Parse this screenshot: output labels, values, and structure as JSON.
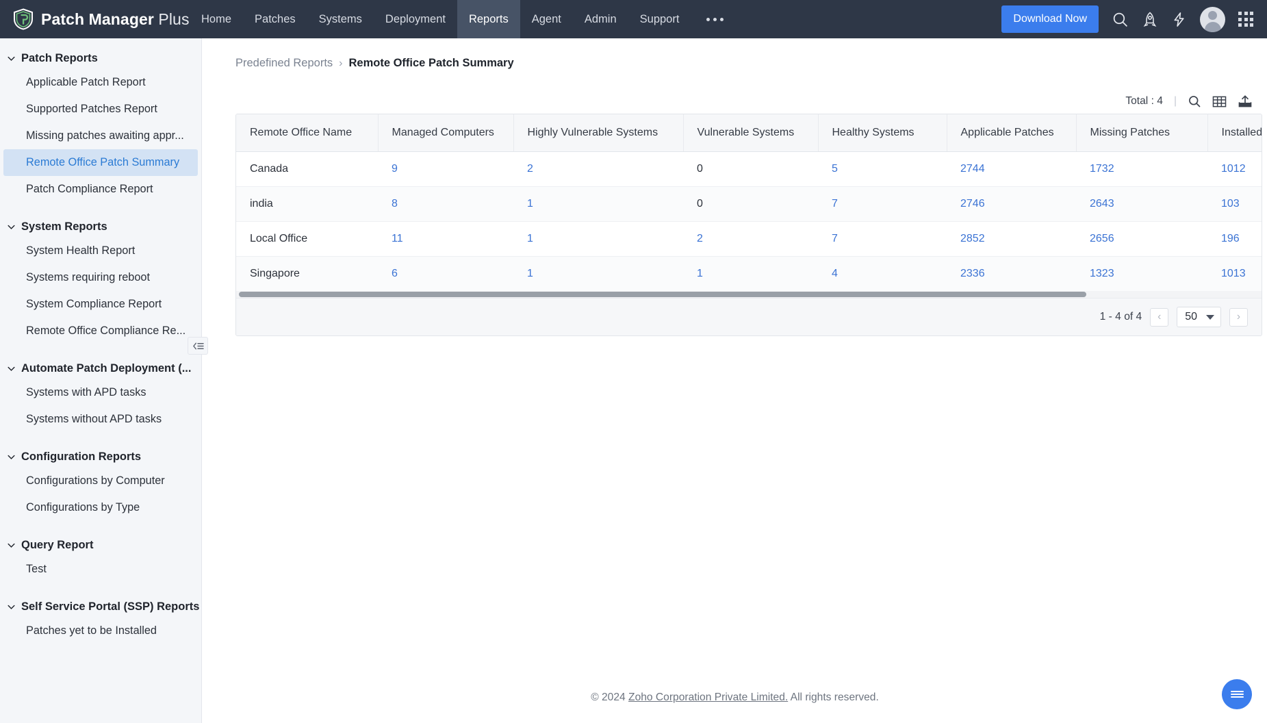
{
  "header": {
    "brand_bold": "Patch Manager",
    "brand_light": "Plus",
    "nav": [
      {
        "label": "Home",
        "active": false
      },
      {
        "label": "Patches",
        "active": false
      },
      {
        "label": "Systems",
        "active": false
      },
      {
        "label": "Deployment",
        "active": false
      },
      {
        "label": "Reports",
        "active": true
      },
      {
        "label": "Agent",
        "active": false
      },
      {
        "label": "Admin",
        "active": false
      },
      {
        "label": "Support",
        "active": false
      }
    ],
    "more_label": "more-menu",
    "download_label": "Download Now",
    "icons": [
      "search-icon",
      "rocket-icon",
      "lightning-icon",
      "avatar",
      "apps-grid-icon"
    ]
  },
  "sidebar": {
    "groups": [
      {
        "title": "Patch Reports",
        "items": [
          {
            "label": "Applicable Patch Report",
            "active": false
          },
          {
            "label": "Supported Patches Report",
            "active": false
          },
          {
            "label": "Missing patches awaiting appr...",
            "active": false
          },
          {
            "label": "Remote Office Patch Summary",
            "active": true
          },
          {
            "label": "Patch Compliance Report",
            "active": false
          }
        ]
      },
      {
        "title": "System Reports",
        "items": [
          {
            "label": "System Health Report",
            "active": false
          },
          {
            "label": "Systems requiring reboot",
            "active": false
          },
          {
            "label": "System Compliance Report",
            "active": false
          },
          {
            "label": "Remote Office Compliance Re...",
            "active": false
          }
        ]
      },
      {
        "title": "Automate Patch Deployment (...",
        "items": [
          {
            "label": "Systems with APD tasks",
            "active": false
          },
          {
            "label": "Systems without APD tasks",
            "active": false
          }
        ]
      },
      {
        "title": "Configuration Reports",
        "items": [
          {
            "label": "Configurations by Computer",
            "active": false
          },
          {
            "label": "Configurations by Type",
            "active": false
          }
        ]
      },
      {
        "title": "Query Report",
        "items": [
          {
            "label": "Test",
            "active": false
          }
        ]
      },
      {
        "title": "Self Service Portal (SSP) Reports",
        "items": [
          {
            "label": "Patches yet to be Installed",
            "active": false
          }
        ]
      }
    ],
    "collapse_icon": "collapse-sidebar-icon"
  },
  "breadcrumb": {
    "parent": "Predefined Reports",
    "separator": "›",
    "current": "Remote Office Patch Summary"
  },
  "toolbar": {
    "total_label": "Total : 4",
    "divider": "|",
    "icons": [
      "search-icon",
      "column-settings-icon",
      "export-icon"
    ]
  },
  "table": {
    "columns": [
      "Remote Office Name",
      "Managed Computers",
      "Highly Vulnerable Systems",
      "Vulnerable Systems",
      "Healthy Systems",
      "Applicable Patches",
      "Missing Patches",
      "Installed Pa"
    ],
    "rows": [
      {
        "cells": [
          {
            "v": "Canada",
            "link": false
          },
          {
            "v": "9",
            "link": true
          },
          {
            "v": "2",
            "link": true
          },
          {
            "v": "0",
            "link": false
          },
          {
            "v": "5",
            "link": true
          },
          {
            "v": "2744",
            "link": true
          },
          {
            "v": "1732",
            "link": true
          },
          {
            "v": "1012",
            "link": true
          }
        ]
      },
      {
        "cells": [
          {
            "v": "india",
            "link": false
          },
          {
            "v": "8",
            "link": true
          },
          {
            "v": "1",
            "link": true
          },
          {
            "v": "0",
            "link": false
          },
          {
            "v": "7",
            "link": true
          },
          {
            "v": "2746",
            "link": true
          },
          {
            "v": "2643",
            "link": true
          },
          {
            "v": "103",
            "link": true
          }
        ]
      },
      {
        "cells": [
          {
            "v": "Local Office",
            "link": false
          },
          {
            "v": "11",
            "link": true
          },
          {
            "v": "1",
            "link": true
          },
          {
            "v": "2",
            "link": true
          },
          {
            "v": "7",
            "link": true
          },
          {
            "v": "2852",
            "link": true
          },
          {
            "v": "2656",
            "link": true
          },
          {
            "v": "196",
            "link": true
          }
        ]
      },
      {
        "cells": [
          {
            "v": "Singapore",
            "link": false
          },
          {
            "v": "6",
            "link": true
          },
          {
            "v": "1",
            "link": true
          },
          {
            "v": "1",
            "link": true
          },
          {
            "v": "4",
            "link": true
          },
          {
            "v": "2336",
            "link": true
          },
          {
            "v": "1323",
            "link": true
          },
          {
            "v": "1013",
            "link": true
          }
        ]
      }
    ]
  },
  "pagination": {
    "range_label": "1 - 4 of 4",
    "prev": "‹",
    "next": "›",
    "page_size": "50"
  },
  "footer": {
    "copyright": "© 2024 ",
    "company": "Zoho Corporation Private Limited.",
    "rights": " All rights reserved.",
    "fab": "chat-menu-fab"
  }
}
